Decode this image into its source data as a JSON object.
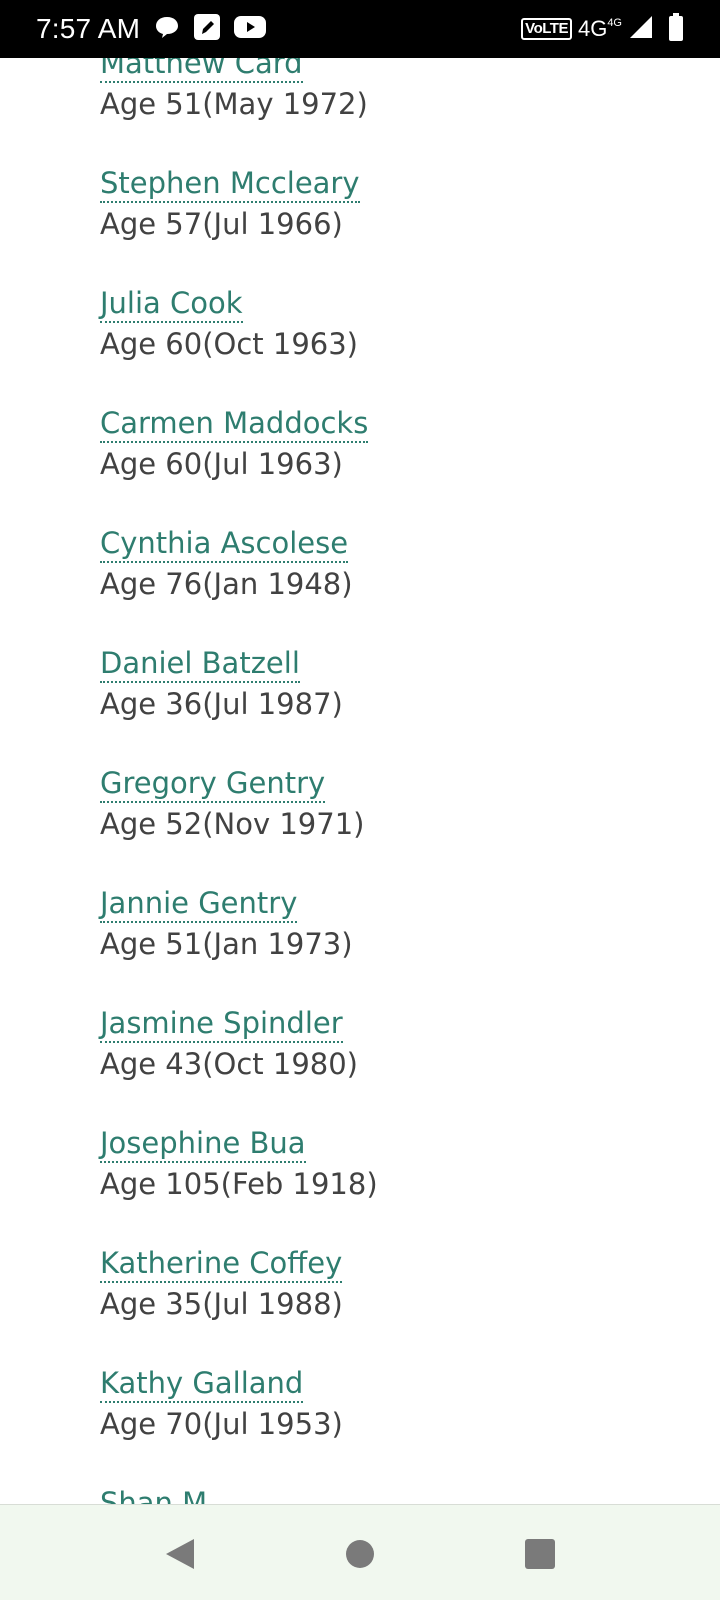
{
  "status_bar": {
    "time": "7:57 AM",
    "left_icons": [
      "chat-bubble-icon",
      "note-edit-icon",
      "youtube-icon"
    ],
    "volte_label": "VoLTE",
    "network_label": "4G",
    "network_sup": "4G",
    "right_icons": [
      "signal-icon",
      "battery-icon"
    ]
  },
  "people": [
    {
      "name": "Matthew Card",
      "age": "Age 51(May 1972)"
    },
    {
      "name": "Stephen Mccleary",
      "age": "Age 57(Jul 1966)"
    },
    {
      "name": "Julia Cook",
      "age": "Age 60(Oct 1963)"
    },
    {
      "name": "Carmen Maddocks",
      "age": "Age 60(Jul 1963)"
    },
    {
      "name": "Cynthia Ascolese",
      "age": "Age 76(Jan 1948)"
    },
    {
      "name": "Daniel Batzell",
      "age": "Age 36(Jul 1987)"
    },
    {
      "name": "Gregory Gentry",
      "age": "Age 52(Nov 1971)"
    },
    {
      "name": "Jannie Gentry",
      "age": "Age 51(Jan 1973)"
    },
    {
      "name": "Jasmine Spindler",
      "age": "Age 43(Oct 1980)"
    },
    {
      "name": "Josephine Bua",
      "age": "Age 105(Feb 1918)"
    },
    {
      "name": "Katherine Coffey",
      "age": "Age 35(Jul 1988)"
    },
    {
      "name": "Kathy Galland",
      "age": "Age 70(Jul 1953)"
    },
    {
      "name": "Shan M",
      "age": ""
    }
  ],
  "nav_bar": {
    "buttons": [
      "back-icon",
      "home-icon",
      "recents-icon"
    ]
  },
  "colors": {
    "link": "#2e7d6f",
    "text": "#424242",
    "nav_bg": "#f1f8ef"
  }
}
